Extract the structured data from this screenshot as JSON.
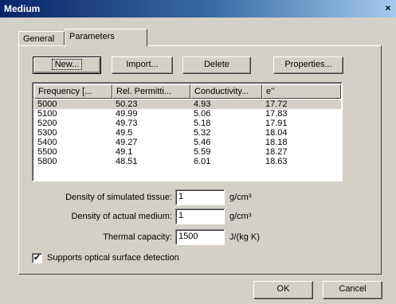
{
  "window": {
    "title": "Medium",
    "close_glyph": "×"
  },
  "tabs": [
    {
      "label": "General",
      "active": false
    },
    {
      "label": "Parameters",
      "active": true
    }
  ],
  "toolbar": {
    "new_label": "New...",
    "import_label": "Import...",
    "delete_label": "Delete",
    "properties_label": "Properties..."
  },
  "table": {
    "columns": [
      "Frequency [...",
      "Rel. Permitti...",
      "Conductivity...",
      "e''"
    ],
    "rows": [
      [
        "5000",
        "50.23",
        "4.93",
        "17.72"
      ],
      [
        "5100",
        "49.99",
        "5.06",
        "17.83"
      ],
      [
        "5200",
        "49.73",
        "5.18",
        "17.91"
      ],
      [
        "5300",
        "49.5",
        "5.32",
        "18.04"
      ],
      [
        "5400",
        "49.27",
        "5.46",
        "18.18"
      ],
      [
        "5500",
        "49.1",
        "5.59",
        "18.27"
      ],
      [
        "5800",
        "48.51",
        "6.01",
        "18.63"
      ]
    ],
    "selected_row": 0
  },
  "fields": {
    "density_simulated": {
      "label": "Density of simulated tissue:",
      "value": "1",
      "unit": "g/cm³"
    },
    "density_actual": {
      "label": "Density of actual medium:",
      "value": "1",
      "unit": "g/cm³"
    },
    "thermal_capacity": {
      "label": "Thermal capacity:",
      "value": "1500",
      "unit": "J/(kg K)"
    }
  },
  "checkbox": {
    "label": "Supports optical surface detection",
    "checked": true,
    "check_glyph": "✔"
  },
  "footer": {
    "ok_label": "OK",
    "cancel_label": "Cancel"
  },
  "colors": {
    "face": "#d4d0c8",
    "title_start": "#0a246a",
    "title_end": "#a6caf0"
  }
}
